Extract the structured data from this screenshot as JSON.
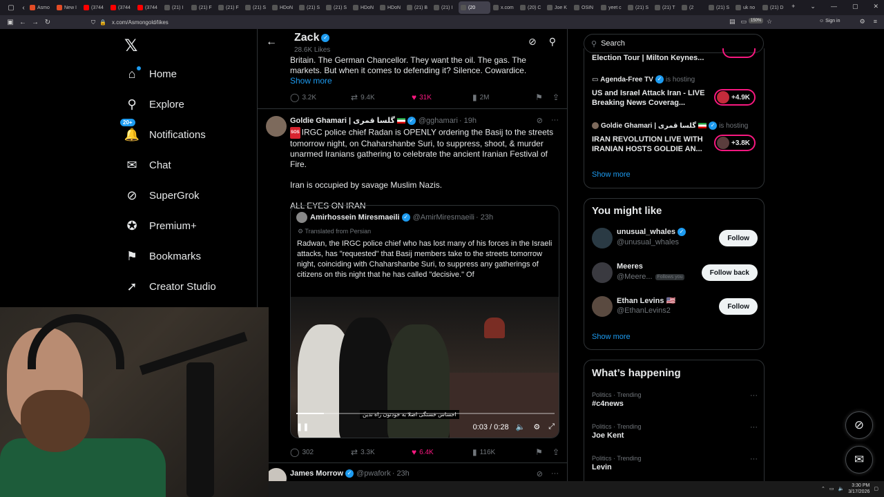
{
  "browser": {
    "tabs": [
      {
        "label": "Asmo",
        "color": "#e34c26"
      },
      {
        "label": "New I",
        "color": "#e34c26"
      },
      {
        "label": "(3744",
        "color": "#ff0000"
      },
      {
        "label": "(3744",
        "color": "#ff0000"
      },
      {
        "label": "(3744",
        "color": "#ff0000"
      },
      {
        "label": "(21) I",
        "color": "#555"
      },
      {
        "label": "(21) F",
        "color": "#555"
      },
      {
        "label": "(21) F",
        "color": "#555"
      },
      {
        "label": "(21) S",
        "color": "#555"
      },
      {
        "label": "HDoN",
        "color": "#555"
      },
      {
        "label": "(21) S",
        "color": "#555"
      },
      {
        "label": "(21) S",
        "color": "#555"
      },
      {
        "label": "HDoN",
        "color": "#555"
      },
      {
        "label": "HDoN",
        "color": "#555"
      },
      {
        "label": "(21) B",
        "color": "#555"
      },
      {
        "label": "(21) I",
        "color": "#555"
      },
      {
        "label": "(20",
        "color": "#555",
        "active": true
      },
      {
        "label": "x.com",
        "color": "#555"
      },
      {
        "label": "(20) C",
        "color": "#555"
      },
      {
        "label": "Joe K",
        "color": "#555"
      },
      {
        "label": "OSIN",
        "color": "#555"
      },
      {
        "label": "yeet c",
        "color": "#555"
      },
      {
        "label": "(21) S",
        "color": "#555"
      },
      {
        "label": "(21) T",
        "color": "#555"
      },
      {
        "label": "(2",
        "color": "#555"
      },
      {
        "label": "(21) S",
        "color": "#555"
      },
      {
        "label": "uk no",
        "color": "#555"
      },
      {
        "label": "(21) D",
        "color": "#555"
      }
    ],
    "url": "x.com/Asmongold/likes",
    "zoom": "150%",
    "signin_label": "Sign in"
  },
  "nav": {
    "items": [
      {
        "label": "Home",
        "icon": "home-icon",
        "glyph": "⌂"
      },
      {
        "label": "Explore",
        "icon": "search-icon",
        "glyph": "⚲"
      },
      {
        "label": "Notifications",
        "icon": "bell-icon",
        "glyph": "🔔",
        "badge": "20+"
      },
      {
        "label": "Chat",
        "icon": "mail-icon",
        "glyph": "✉"
      },
      {
        "label": "SuperGrok",
        "icon": "grok-icon",
        "glyph": "⊘"
      },
      {
        "label": "Premium+",
        "icon": "premium-icon",
        "glyph": "✪"
      },
      {
        "label": "Bookmarks",
        "icon": "bookmark-icon",
        "glyph": "⚑"
      },
      {
        "label": "Creator Studio",
        "icon": "rocket-icon",
        "glyph": "➚"
      }
    ]
  },
  "profile": {
    "name": "Zack",
    "likes": "28.6K Likes"
  },
  "tweet1": {
    "text": "Britain. The German Chancellor. They want the oil. The gas. The markets. But when it comes to defending it? Silence. Cowardice.",
    "show_more": "Show more",
    "replies": "3.2K",
    "reposts": "9.4K",
    "likes": "31K",
    "views": "2M"
  },
  "tweet2": {
    "name": "Goldie Ghamari | گلسا قمری",
    "handle": "@gghamari",
    "time": "· 19h",
    "sos": "SOS",
    "text1": "IRGC police chief Radan is OPENLY ordering the Basij to the streets tomorrow night, on Chaharshanbe Suri, to suppress, shoot, & murder unarmed Iranians gathering to celebrate the ancient Iranian Festival of Fire.",
    "text2": "Iran is occupied by savage Muslim Nazis.",
    "text3": "ALL EYES ON IRAN",
    "quote": {
      "name": "Amirhossein Miresmaeili",
      "handle": "@AmirMiresmaeili",
      "time": "· 23h",
      "translated": "Translated from Persian",
      "text": "Radwan, the IRGC police chief who has lost many of his forces in the Israeli attacks, has \"requested\" that Basij members take to the streets tomorrow night, coinciding with Chaharshanbe Suri, to suppress any gatherings of citizens on this night that he has called \"decisive.\" Of",
      "video_caption": "احساس خستگی اصلا به خودتون راه ندین",
      "video_time": "0:03 / 0:28",
      "progress": 0.107
    },
    "replies": "302",
    "reposts": "3.3K",
    "likes": "6.4K",
    "views": "116K"
  },
  "tweet3": {
    "name": "James Morrow",
    "handle": "@pwafork",
    "time": "· 23h"
  },
  "sidebar": {
    "search_placeholder": "Search",
    "live": [
      {
        "title": "Election Tour | Milton Keynes...",
        "host": "",
        "host_suffix": "",
        "count": ""
      },
      {
        "host": "Agenda-Free TV",
        "host_suffix": "is hosting",
        "title": "US and Israel Attack Iran - LIVE Breaking News Coverag...",
        "count": "+4.9K"
      },
      {
        "host": "Goldie Ghamari | گلسا قمری",
        "host_suffix": "is hosting",
        "title": "IRAN REVOLUTION LIVE WITH IRANIAN HOSTS GOLDIE AN...",
        "count": "+3.8K"
      }
    ],
    "live_show_more": "Show more",
    "you_might_like": {
      "title": "You might like",
      "users": [
        {
          "name": "unusual_whales",
          "handle": "@unusual_whales",
          "button": "Follow",
          "follows_you": ""
        },
        {
          "name": "Meeres",
          "handle": "@Meere...",
          "button": "Follow back",
          "follows_you": "Follows you"
        },
        {
          "name": "Ethan Levins 🇺🇸",
          "handle": "@EthanLevins2",
          "button": "Follow",
          "follows_you": ""
        }
      ],
      "show_more": "Show more"
    },
    "whats_happening": {
      "title": "What’s happening",
      "trends": [
        {
          "category": "Politics · Trending",
          "name": "#c4news"
        },
        {
          "category": "Politics · Trending",
          "name": "Joe Kent"
        },
        {
          "category": "Politics · Trending",
          "name": "Levin"
        }
      ]
    }
  },
  "taskbar": {
    "time": "3:30 PM",
    "date": "3/17/2026"
  },
  "colors": {
    "accent": "#1d9bf0",
    "like": "#f91880",
    "bg": "#000000",
    "border": "#2f3336"
  }
}
